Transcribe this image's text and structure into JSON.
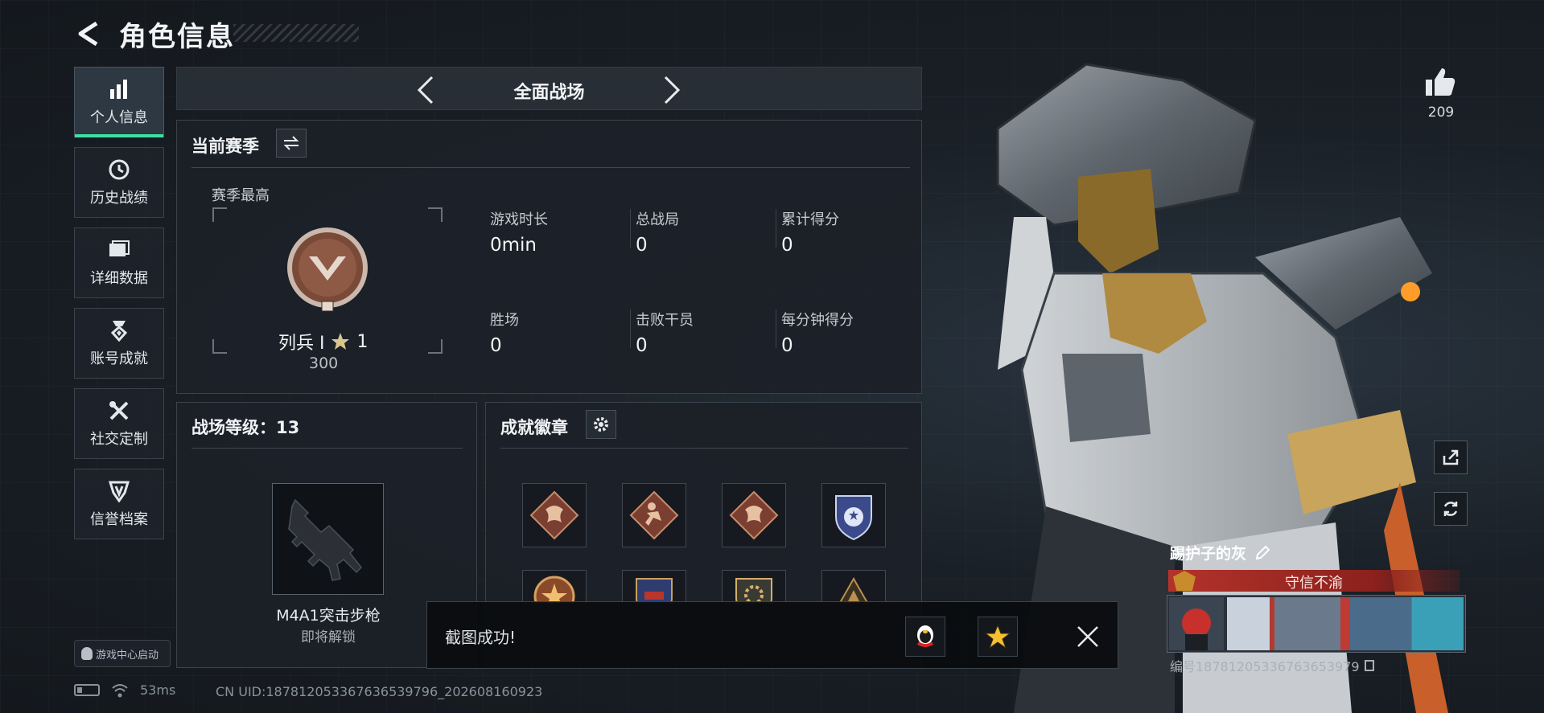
{
  "header": {
    "title": "角色信息"
  },
  "sidebar": {
    "items": [
      {
        "label": "个人信息",
        "icon": "bar-chart-icon",
        "active": true
      },
      {
        "label": "历史战绩",
        "icon": "clock-icon",
        "active": false
      },
      {
        "label": "详细数据",
        "icon": "folder-icon",
        "active": false
      },
      {
        "label": "账号成就",
        "icon": "medal-icon",
        "active": false
      },
      {
        "label": "社交定制",
        "icon": "tools-icon",
        "active": false
      },
      {
        "label": "信誉档案",
        "icon": "shield-icon",
        "active": false
      }
    ],
    "game_center": "游戏中心启动"
  },
  "mode_selector": {
    "title": "全面战场"
  },
  "season": {
    "title": "当前赛季",
    "best_label": "赛季最高",
    "rank_name": "列兵 Ⅰ",
    "rank_stars": "1",
    "rank_score": "300",
    "stats": [
      {
        "label": "游戏时长",
        "value": "0min"
      },
      {
        "label": "总战局",
        "value": "0"
      },
      {
        "label": "累计得分",
        "value": "0"
      },
      {
        "label": "胜场",
        "value": "0"
      },
      {
        "label": "击败干员",
        "value": "0"
      },
      {
        "label": "每分钟得分",
        "value": "0"
      }
    ]
  },
  "battlefield_level": {
    "title": "战场等级：13",
    "weapon_name": "M4A1突击步枪",
    "weapon_status": "即将解锁"
  },
  "achievements": {
    "title": "成就徽章",
    "badges": [
      "dragon-badge",
      "runner-badge",
      "dragon-badge",
      "shield-star-badge",
      "star-emblem-badge",
      "shield-badge",
      "gear-badge",
      "triangle-badge"
    ]
  },
  "status_bar": {
    "ping": "53ms",
    "uid": "CN UID:18781205336763653979​6_202608160923"
  },
  "toast": {
    "message": "截图成功!"
  },
  "character": {
    "likes": "209",
    "player_name": "踢护子的灰",
    "credit": "守信不渝",
    "card_id": "编号18781205336763653979"
  },
  "colors": {
    "accent": "#3ee0a3",
    "credit_red": "#b3332b",
    "badge_bronze": "#7a4a38"
  }
}
